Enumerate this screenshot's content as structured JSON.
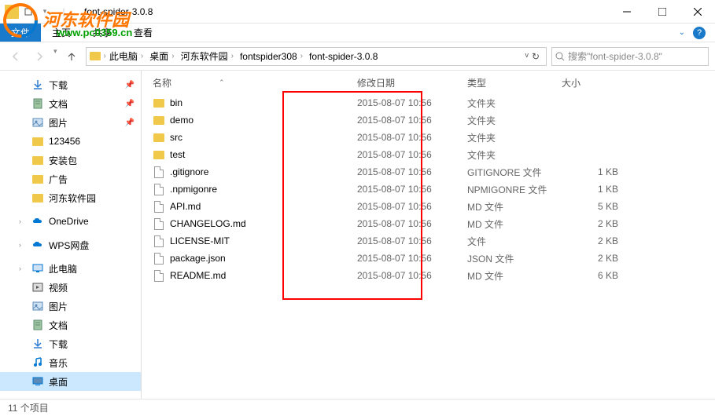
{
  "title_bar": {
    "title": "font-spider-3.0.8"
  },
  "ribbon": {
    "tabs": [
      "文件",
      "主页",
      "共享",
      "查看"
    ]
  },
  "breadcrumb": {
    "items": [
      "此电脑",
      "桌面",
      "河东软件园",
      "fontspider308",
      "font-spider-3.0.8"
    ]
  },
  "search": {
    "placeholder": "搜索\"font-spider-3.0.8\""
  },
  "sidebar": {
    "items": [
      {
        "label": "下载",
        "icon": "download",
        "pinned": true,
        "indent": true
      },
      {
        "label": "文档",
        "icon": "document",
        "pinned": true,
        "indent": true
      },
      {
        "label": "图片",
        "icon": "pictures",
        "pinned": true,
        "indent": true
      },
      {
        "label": "123456",
        "icon": "folder",
        "indent": true
      },
      {
        "label": "安装包",
        "icon": "folder",
        "indent": true
      },
      {
        "label": "广告",
        "icon": "folder",
        "indent": true
      },
      {
        "label": "河东软件园",
        "icon": "folder",
        "indent": true
      },
      {
        "label": "",
        "spacer": true
      },
      {
        "label": "OneDrive",
        "icon": "onedrive",
        "chevron": true
      },
      {
        "label": "",
        "spacer": true
      },
      {
        "label": "WPS网盘",
        "icon": "wps",
        "chevron": true
      },
      {
        "label": "",
        "spacer": true
      },
      {
        "label": "此电脑",
        "icon": "pc",
        "chevron": true
      },
      {
        "label": "视频",
        "icon": "video",
        "indent": true
      },
      {
        "label": "图片",
        "icon": "pictures",
        "indent": true
      },
      {
        "label": "文档",
        "icon": "document",
        "indent": true
      },
      {
        "label": "下载",
        "icon": "download",
        "indent": true
      },
      {
        "label": "音乐",
        "icon": "music",
        "indent": true
      },
      {
        "label": "桌面",
        "icon": "desktop",
        "indent": true,
        "selected": true
      }
    ]
  },
  "columns": {
    "name": "名称",
    "date": "修改日期",
    "type": "类型",
    "size": "大小"
  },
  "files": [
    {
      "name": "bin",
      "date": "2015-08-07 10:56",
      "type": "文件夹",
      "size": "",
      "icon": "folder"
    },
    {
      "name": "demo",
      "date": "2015-08-07 10:56",
      "type": "文件夹",
      "size": "",
      "icon": "folder"
    },
    {
      "name": "src",
      "date": "2015-08-07 10:56",
      "type": "文件夹",
      "size": "",
      "icon": "folder"
    },
    {
      "name": "test",
      "date": "2015-08-07 10:56",
      "type": "文件夹",
      "size": "",
      "icon": "folder"
    },
    {
      "name": ".gitignore",
      "date": "2015-08-07 10:56",
      "type": "GITIGNORE 文件",
      "size": "1 KB",
      "icon": "file"
    },
    {
      "name": ".npmigonre",
      "date": "2015-08-07 10:56",
      "type": "NPMIGONRE 文件",
      "size": "1 KB",
      "icon": "file"
    },
    {
      "name": "API.md",
      "date": "2015-08-07 10:56",
      "type": "MD 文件",
      "size": "5 KB",
      "icon": "file"
    },
    {
      "name": "CHANGELOG.md",
      "date": "2015-08-07 10:56",
      "type": "MD 文件",
      "size": "2 KB",
      "icon": "file"
    },
    {
      "name": "LICENSE-MIT",
      "date": "2015-08-07 10:56",
      "type": "文件",
      "size": "2 KB",
      "icon": "file"
    },
    {
      "name": "package.json",
      "date": "2015-08-07 10:56",
      "type": "JSON 文件",
      "size": "2 KB",
      "icon": "file"
    },
    {
      "name": "README.md",
      "date": "2015-08-07 10:56",
      "type": "MD 文件",
      "size": "6 KB",
      "icon": "file"
    }
  ],
  "status": {
    "count": "11 个项目"
  },
  "watermark": {
    "text": "河东软件园",
    "url": "www.pc0359.cn"
  }
}
